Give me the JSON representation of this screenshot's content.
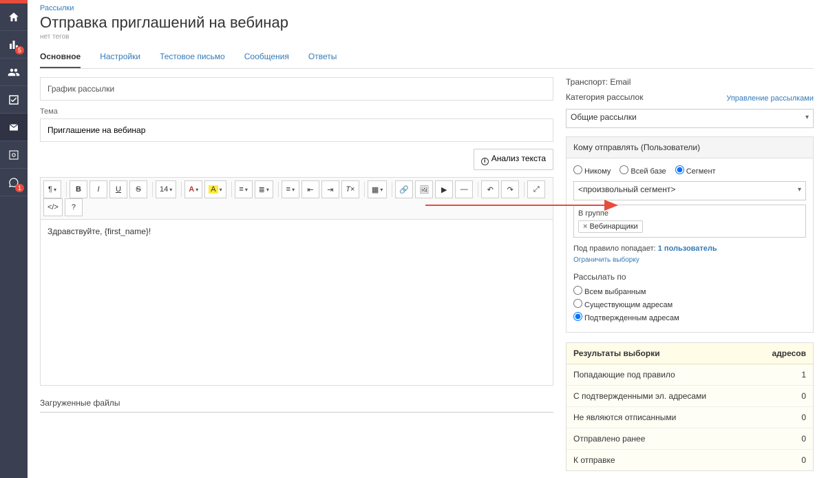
{
  "sidebar": {
    "badges": {
      "stats": "5",
      "comment": "1"
    }
  },
  "breadcrumb": "Рассылки",
  "title": "Отправка приглашений на вебинар",
  "no_tags": "нет тегов",
  "tabs": [
    "Основное",
    "Настройки",
    "Тестовое письмо",
    "Сообщения",
    "Ответы"
  ],
  "left": {
    "schedule": "График рассылки",
    "subject_label": "Тема",
    "subject_value": "Приглашение на вебинар",
    "analysis_btn": "Анализ текста",
    "editor_text": "Здравствуйте, {first_name}!",
    "uploaded": "Загруженные файлы",
    "toolbar": {
      "fontsize": "14",
      "bold": "B",
      "italic": "I",
      "underline": "U",
      "strike": "S",
      "hl": "А"
    }
  },
  "right": {
    "transport": "Транспорт: Email",
    "cat_label": "Категория рассылок",
    "manage": "Управление рассылками",
    "cat_value": "Общие рассылки",
    "recipients": {
      "header": "Кому отправлять (Пользователи)",
      "options": [
        "Никому",
        "Всей базе",
        "Сегмент"
      ],
      "selected": 2,
      "segment_select": "<произвольный сегмент>",
      "group_label": "В группе",
      "tag": "Вебинарщики",
      "rule_prefix": "Под правило попадает: ",
      "rule_count": "1 пользователь",
      "limit": "Ограничить выборку"
    },
    "send_by": {
      "title": "Рассылать по",
      "options": [
        "Всем выбранным",
        "Существующим адресам",
        "Подтвержденным адресам"
      ],
      "selected": 2
    },
    "results": {
      "header": "Результаты выборки",
      "header_col": "адресов",
      "rows": [
        {
          "l": "Попадающие под правило",
          "v": "1"
        },
        {
          "l": "С подтвержденными эл. адресами",
          "v": "0"
        },
        {
          "l": "Не являются отписанными",
          "v": "0"
        },
        {
          "l": "Отправлено ранее",
          "v": "0"
        },
        {
          "l": "К отправке",
          "v": "0"
        }
      ]
    }
  }
}
